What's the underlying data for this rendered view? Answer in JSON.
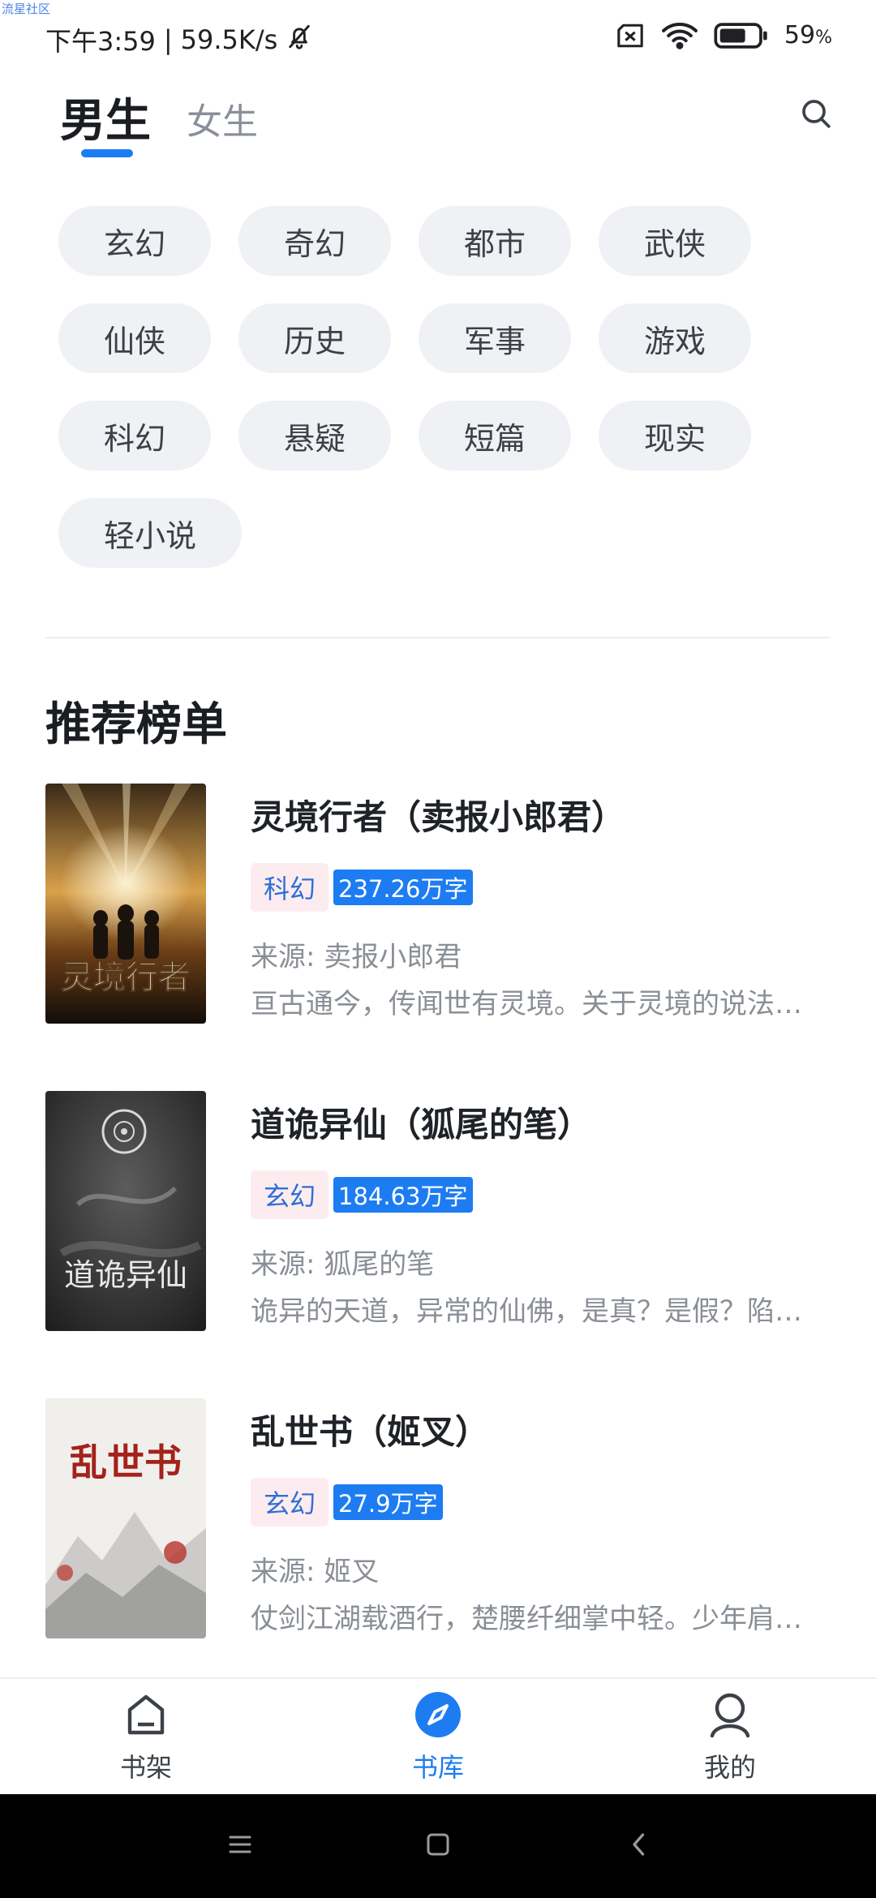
{
  "watermark": "流星社区",
  "status_bar": {
    "time": "下午3:59",
    "separator": "|",
    "net_speed": "59.5K/s",
    "battery": "59",
    "battery_unit": "%",
    "icons": [
      "bell-off-icon",
      "sim-off-icon",
      "wifi-icon",
      "battery-icon"
    ]
  },
  "top_tabs": {
    "tabs": [
      {
        "label": "男生",
        "active": true
      },
      {
        "label": "女生",
        "active": false
      }
    ],
    "search_icon": "search-icon",
    "accent": "#1d7cf2"
  },
  "categories": [
    "玄幻",
    "奇幻",
    "都市",
    "武侠",
    "仙侠",
    "历史",
    "军事",
    "游戏",
    "科幻",
    "悬疑",
    "短篇",
    "现实",
    "轻小说"
  ],
  "section": {
    "title": "推荐榜单"
  },
  "books": [
    {
      "title": "灵境行者（卖报小郎君）",
      "genre": "科幻",
      "words": "237.26万字",
      "source": "来源: 卖报小郎君",
      "desc": "亘古通今，传闻世有灵境。关于灵境的说法…",
      "cover_text": "灵境行者"
    },
    {
      "title": "道诡异仙（狐尾的笔）",
      "genre": "玄幻",
      "words": "184.63万字",
      "source": "来源: 狐尾的笔",
      "desc": "诡异的天道，异常的仙佛，是真？是假？陷…",
      "cover_text": "道诡异仙"
    },
    {
      "title": "乱世书（姬叉）",
      "genre": "玄幻",
      "words": "27.9万字",
      "source": "来源: 姬叉",
      "desc": "仗剑江湖载酒行，楚腰纤细掌中轻。少年肩…",
      "cover_text": "乱世书"
    }
  ],
  "bottom_nav": {
    "items": [
      {
        "label": "书架",
        "icon": "bookshelf-icon",
        "active": false
      },
      {
        "label": "书库",
        "icon": "compass-icon",
        "active": true
      },
      {
        "label": "我的",
        "icon": "user-icon",
        "active": false
      }
    ]
  },
  "system_nav": {
    "icons": [
      "menu-icon",
      "home-icon",
      "back-icon"
    ]
  }
}
